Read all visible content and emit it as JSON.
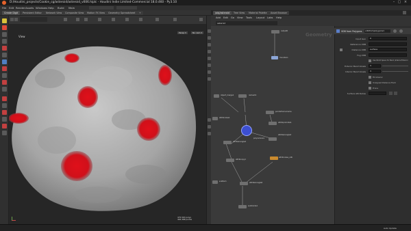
{
  "window": {
    "title": "D:/Houdini_projects/Cookie_cg/asteroid/asteroid_v006.hiplc - Houdini Indie Limited-Commercial 18.0.460 - Py3.10"
  },
  "menu": [
    "File",
    "Edit",
    "Render",
    "Assets",
    "Windows",
    "Help",
    "Build",
    "Main"
  ],
  "shelf": {
    "tabs": [
      "Create Digit",
      "Persistent Editor",
      "Network View",
      "Composite View",
      "Motion FX View",
      "Geometry Spreadsheet"
    ],
    "add_tab": "+"
  },
  "viewport": {
    "pane_label": "View",
    "camera_button": "Persp ▾",
    "no_cam_button": "No cam ▾",
    "hud_stats": "475,563 polys\n463,388 points",
    "colors": {
      "background": "#262626",
      "rock": "#a9a9a9",
      "spots": "#e0101a"
    }
  },
  "network": {
    "pane_tabs": [
      "/obj/asteroid",
      "Tree View",
      "Material Palette",
      "Asset Browser"
    ],
    "menu": [
      "Add",
      "Edit",
      "Go",
      "View",
      "Tools",
      "Layout",
      "Labs",
      "Help"
    ],
    "path": "asteroid",
    "context_label": "Geometry",
    "nodes": [
      {
        "name": "output0",
        "color": "#6f6f6f"
      },
      {
        "name": "mountain",
        "color": "#6f6f6f"
      },
      {
        "name": "object_merge1",
        "color": "#6f6f6f"
      },
      {
        "name": "remesh1",
        "color": "#6f6f6f"
      },
      {
        "name": "pointsfromvolume",
        "color": "#6f6f6f"
      },
      {
        "name": "attribnoise1",
        "color": "#6f6f6f"
      },
      {
        "name": "attribpromote1",
        "color": "#6f6f6f"
      },
      {
        "name": "polyreduce1",
        "color": "#6f6f6f"
      },
      {
        "name": "attribwrangle2",
        "color": "#6f6f6f"
      },
      {
        "name": "attribwrangle4",
        "color": "#6f6f6f"
      },
      {
        "name": "attribcopy1",
        "color": "#6f6f6f"
      },
      {
        "name": "attribfrompieces",
        "color": "#6f6f6f"
      },
      {
        "name": "scatter1",
        "color": "#6f6f6f"
      },
      {
        "name": "attribwrangle6",
        "color": "#6f6f6f"
      },
      {
        "name": "polysplit_fill",
        "color": "#6f6f6f"
      },
      {
        "name": "polyfill_mesh",
        "color": "#6f6f6f"
      },
      {
        "name": "subdivide1",
        "color": "#6f6f6f"
      },
      {
        "name": "attribnoise_vdb",
        "color": "#c98a2e"
      }
    ],
    "selected_node_label": "mountain"
  },
  "parameters": {
    "node_type": "VDB from Polygons",
    "node_name": "vdbfrompolygons1",
    "rows": [
      {
        "label": "Input Geo",
        "value": "0"
      },
      {
        "label": "Reference VDB",
        "value": ""
      },
      {
        "label": "Distance VDB",
        "value": "surface"
      },
      {
        "label": "Fog VDB",
        "value": ""
      },
      {
        "label": "Exterior Band Voxels",
        "value": "3"
      },
      {
        "label": "Interior Band Voxels",
        "value": "3"
      },
      {
        "label": "Fill Interior",
        "value": ""
      },
      {
        "label": "Unsigned Distance Field",
        "value": ""
      },
      {
        "label": "Prune",
        "value": ""
      },
      {
        "label": "Surface Attributes",
        "value": ""
      }
    ],
    "extra_options": "Use World Space for Band (Interior/Exterior)"
  },
  "status": {
    "text": "",
    "right": "Auto Update"
  }
}
